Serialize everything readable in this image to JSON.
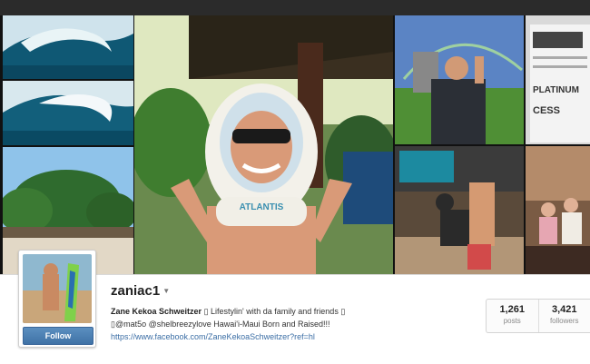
{
  "profile": {
    "username": "zaniac1",
    "caret_icon": "chevron-down-icon",
    "full_name": "Zane Kekoa Schweitzer",
    "bio_line1": " Lifestylin' with da family and friends ",
    "bio_line2": "@mat5o @shelbreezylove Hawai'i-Maui Born and Raised!!!",
    "box_glyph": "▯",
    "link": "https://www.facebook.com/ZaneKekoaSchweitzer?ref=hl",
    "follow_label": "Follow"
  },
  "stats": {
    "posts_count": "1,261",
    "posts_label": "posts",
    "followers_count": "3,421",
    "followers_label": "followers"
  },
  "photos": {
    "helmet_text": "ATLANTIS",
    "ticket_line1": "PLATINUM",
    "ticket_line2": "CESS"
  },
  "colors": {
    "follow_button": "#4a7eb4",
    "link": "#3b6ea5"
  }
}
